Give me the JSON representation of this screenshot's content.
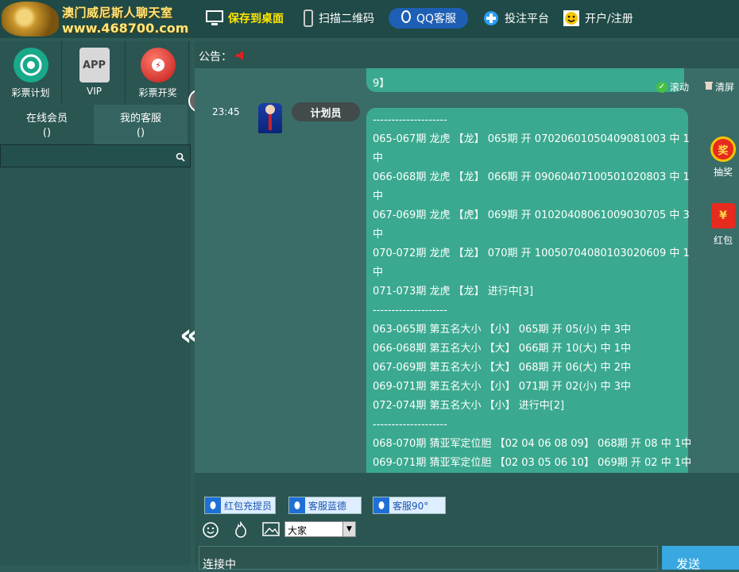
{
  "header": {
    "logo_line1": "澳门威尼斯人聊天室",
    "logo_line2": "www.468700.com",
    "nav": [
      {
        "label": "保存到桌面",
        "icon": "monitor-icon"
      },
      {
        "label": "扫描二维码",
        "icon": "phone-icon"
      },
      {
        "label": "QQ客服",
        "icon": "qq-icon"
      },
      {
        "label": "投注平台",
        "icon": "plus-icon"
      },
      {
        "label": "开户/注册",
        "icon": "smiley-icon"
      }
    ]
  },
  "sidebar": {
    "tiles": [
      {
        "label": "彩票计划",
        "icon": "lottery-plan-icon"
      },
      {
        "label": "VIP",
        "icon": "app-icon",
        "icon_text": "APP"
      },
      {
        "label": "彩票开奖",
        "icon": "lottery-draw-icon"
      }
    ],
    "tabs": [
      {
        "label": "在线会员",
        "count": "()"
      },
      {
        "label": "我的客服",
        "count": "()"
      }
    ],
    "search_placeholder": ""
  },
  "notice": {
    "label": "公告："
  },
  "chat": {
    "top_fragment": "9】",
    "scroll_label": "滚动",
    "clear_label": "清屏",
    "message": {
      "time": "23:45",
      "sender": "计划员",
      "lines": [
        "--------------------",
        "065-067期 龙虎 【龙】 065期 开 07020601050409081003 中 1",
        "中",
        "066-068期 龙虎 【龙】 066期 开 09060407100501020803 中 1",
        "中",
        "067-069期 龙虎 【虎】 069期 开 01020408061009030705 中 3",
        "中",
        "070-072期 龙虎 【龙】 070期 开 10050704080103020609 中 1",
        "中",
        "071-073期 龙虎 【龙】 进行中[3]",
        "--------------------",
        "063-065期 第五名大小 【小】 065期 开 05(小) 中 3中",
        "066-068期 第五名大小 【大】 066期 开 10(大) 中 1中",
        "067-069期 第五名大小 【大】 068期 开 06(大) 中 2中",
        "069-071期 第五名大小 【小】 071期 开 02(小) 中 3中",
        "072-074期 第五名大小 【小】 进行中[2]",
        "--------------------",
        "068-070期 猜亚军定位胆 【02 04 06 08 09】 068期 开 08 中 1中",
        "069-071期 猜亚军定位胆 【02 03 05 06 10】 069期 开 02 中 1中"
      ]
    }
  },
  "side_actions": [
    {
      "label": "抽奖",
      "icon": "lottery-icon",
      "icon_text": "奖"
    },
    {
      "label": "红包",
      "icon": "red-envelope-icon",
      "icon_text": "¥"
    }
  ],
  "service_buttons": [
    "红包充提员",
    "客服蓝德",
    "客服90°"
  ],
  "composer": {
    "channel_select": "大家",
    "input_text": "连接中",
    "send_label": "发送"
  },
  "colors": {
    "bubble": "#3aa98f",
    "panel": "#2a5551",
    "chat_bg": "#3a6d68",
    "save_yellow": "#ffe600",
    "qq_blue": "#1e5fb5",
    "send_blue": "#39a8e0"
  }
}
